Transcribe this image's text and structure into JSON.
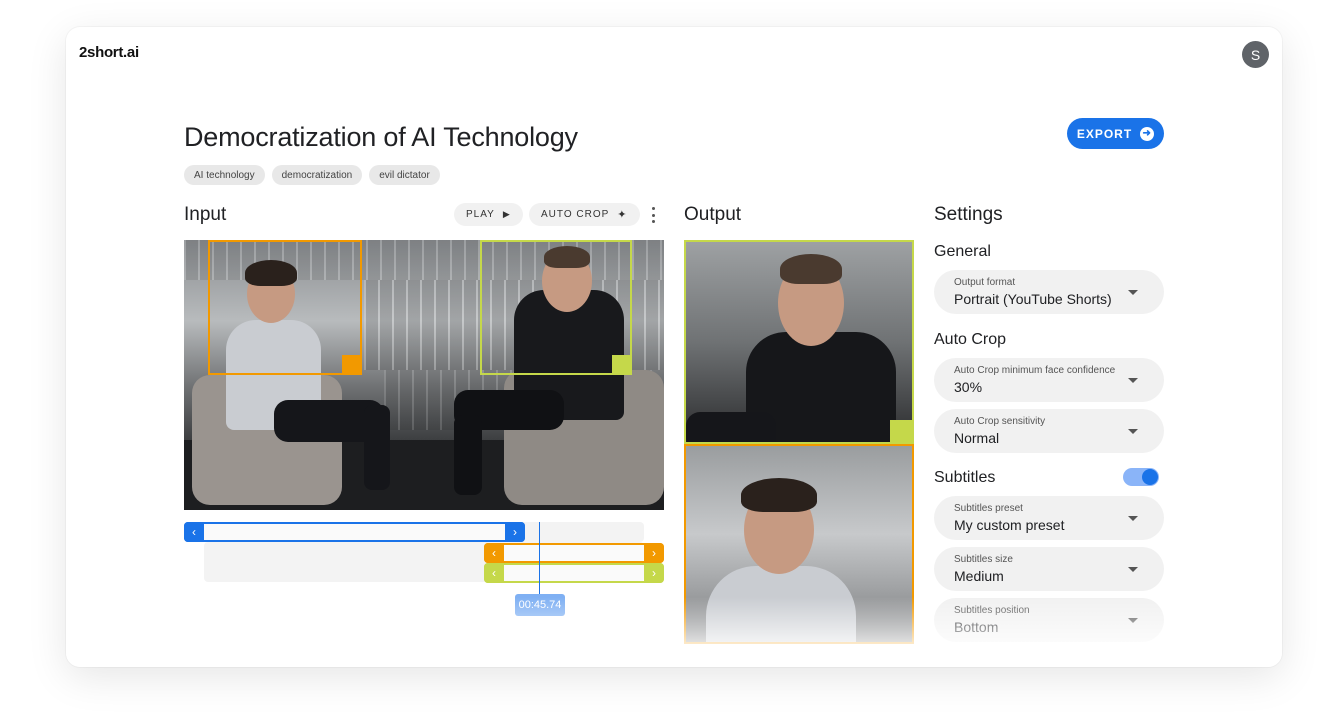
{
  "app": {
    "logo": "2short.ai",
    "avatar_initial": "S"
  },
  "project": {
    "title": "Democratization of AI Technology",
    "tags": [
      "AI technology",
      "democratization",
      "evil dictator"
    ],
    "export_label": "EXPORT"
  },
  "input": {
    "heading": "Input",
    "play_label": "PLAY",
    "auto_crop_label": "AUTO CROP",
    "timestamp": "00:45.74"
  },
  "output": {
    "heading": "Output"
  },
  "settings": {
    "heading": "Settings",
    "general": {
      "heading": "General",
      "output_format": {
        "label": "Output format",
        "value": "Portrait (YouTube Shorts)"
      }
    },
    "auto_crop": {
      "heading": "Auto Crop",
      "min_face_confidence": {
        "label": "Auto Crop minimum face confidence",
        "value": "30%"
      },
      "sensitivity": {
        "label": "Auto Crop sensitivity",
        "value": "Normal"
      }
    },
    "subtitles": {
      "heading": "Subtitles",
      "enabled": true,
      "preset": {
        "label": "Subtitles preset",
        "value": "My custom preset"
      },
      "size": {
        "label": "Subtitles size",
        "value": "Medium"
      },
      "position": {
        "label": "Subtitles position",
        "value": "Bottom"
      }
    }
  },
  "colors": {
    "accent": "#1a73e8",
    "crop_orange": "#f29900",
    "crop_lime": "#c5d84a"
  },
  "icons": {
    "play": "play-icon",
    "auto_crop": "magic-wand-icon",
    "export": "arrow-circle-right-icon",
    "more": "more-vert-icon"
  }
}
